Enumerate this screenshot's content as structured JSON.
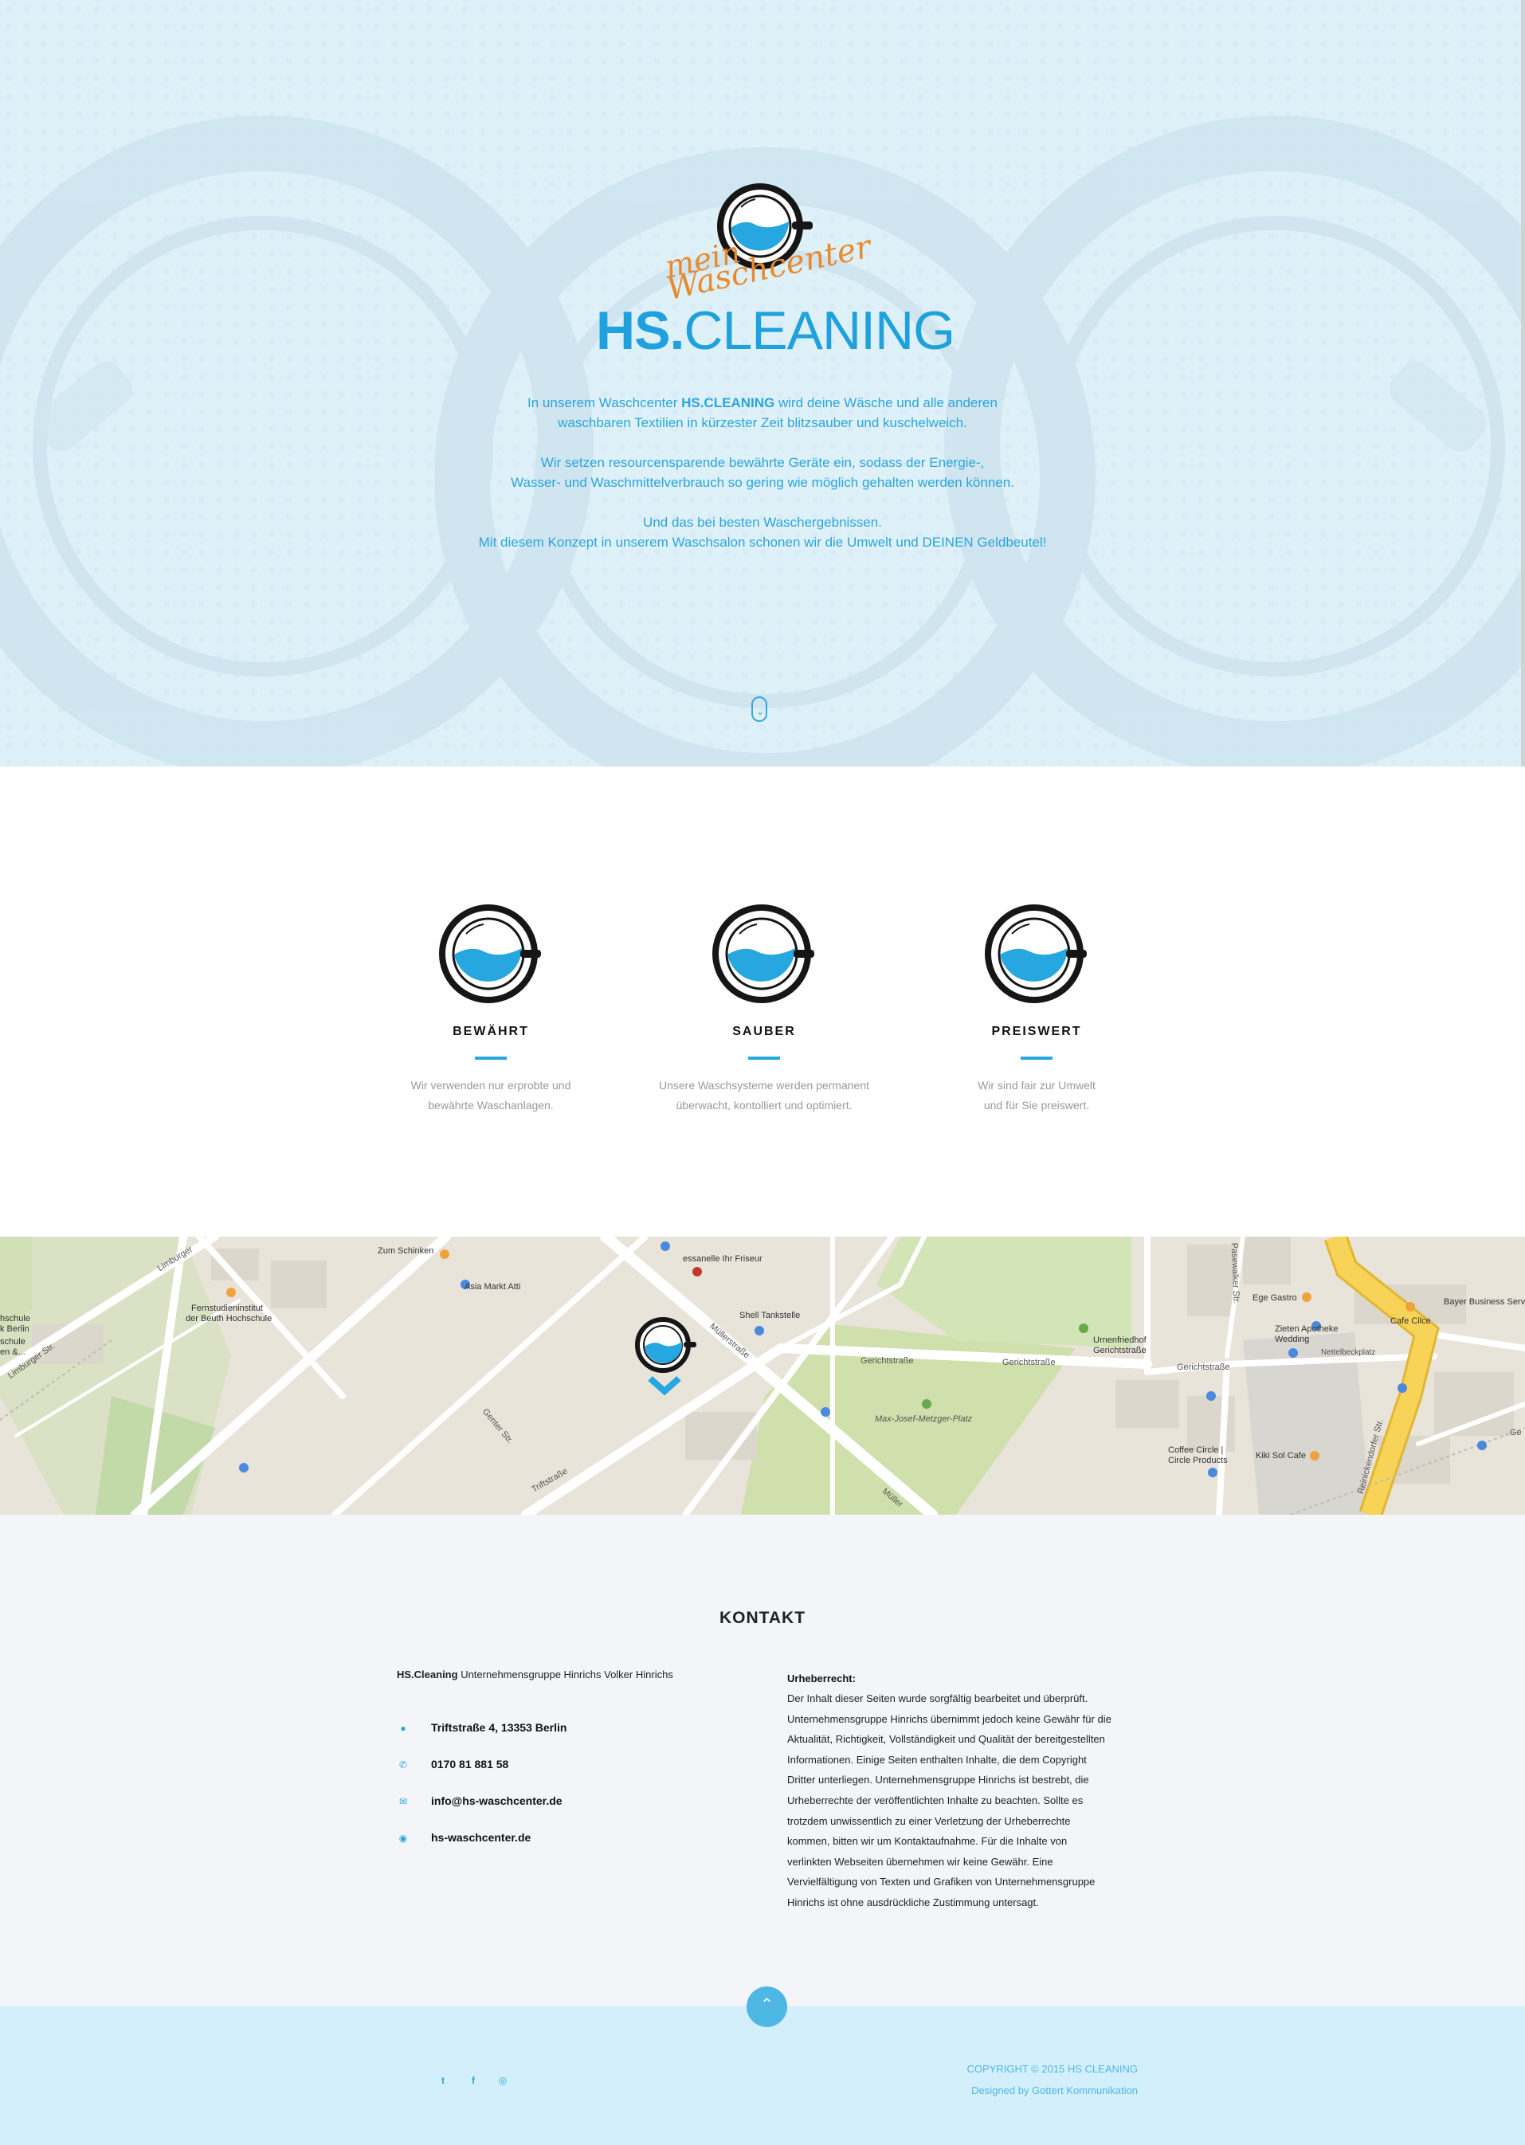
{
  "hero": {
    "logo": {
      "script_line1": "mein",
      "script_line2": "Waschcenter",
      "word_bold": "HS.",
      "word_thin": "CLEANING"
    },
    "p1_pre": "In unserem Waschcenter ",
    "p1_bold": "HS.CLEANING",
    "p1_post": " wird deine Wäsche und alle anderen",
    "p1_line2": "waschbaren Textilien in kürzester Zeit blitzsauber und kuschelweich.",
    "p2_line1": "Wir setzen resourcensparende bewährte Geräte ein, sodass der Energie-,",
    "p2_line2": "Wasser- und Waschmittelverbrauch so gering wie möglich gehalten werden können.",
    "p3_line1": "Und das bei besten Waschergebnissen.",
    "p3_line2": "Mit diesem Konzept in unserem Waschsalon schonen wir die Umwelt und DEINEN Geldbeutel!",
    "scroll_icon": "chevron-down-icon"
  },
  "features": [
    {
      "title": "BEWÄHRT",
      "line1": "Wir verwenden nur erprobte und",
      "line2": "bewährte Waschanlagen.",
      "icon": "washing-drum-icon"
    },
    {
      "title": "SAUBER",
      "line1": "Unsere Waschsysteme werden permanent",
      "line2": "überwacht, kontolliert und optimiert.",
      "icon": "washing-drum-icon"
    },
    {
      "title": "PREISWERT",
      "line1": "Wir sind fair zur Umwelt",
      "line2": "und für Sie preiswert.",
      "icon": "washing-drum-icon"
    }
  ],
  "map": {
    "labels": {
      "zum_schinken": "Zum Schinken",
      "asia_markt": "Asia Markt Atti",
      "friseur": "essanelle Ihr Friseur",
      "shell": "Shell Tankstelle",
      "fernstudien1": "Fernstudieninstitut",
      "fernstudien2": "der Beuth Hochschule",
      "hochschule1": "hschule",
      "hochschule2": "k Berlin",
      "hochschule3": "schule",
      "hochschule4": "en &...",
      "limburger1": "Limburger",
      "limburger2": "Limburger Str.",
      "genter": "Genter Str.",
      "trift": "Triftstraße",
      "mueller1": "Müllerstraße",
      "mueller2": "Müller",
      "gericht1": "Gerichtstraße",
      "gericht2": "Gerichtstraße",
      "gericht3": "Gerichtstraße",
      "urnenfriedhof1": "Urnenfriedhof",
      "urnenfriedhof2": "Gerichtstraße",
      "max_josef": "Max-Josef-Metzger-Platz",
      "pasewalker": "Pasewalker Str.",
      "ege": "Ege Gastro",
      "cafe_cilce": "Cafe Cilce",
      "zieten1": "Zieten Apotheke",
      "zieten2": "Wedding",
      "nettelbeck": "Nettelbeckplatz",
      "bayer": "Bayer Business Servi",
      "coffee1": "Coffee Circle |",
      "coffee2": "Circle Products",
      "kiki": "Kiki Sol Cafe",
      "reinickendorfer": "Reinickendorfer Str.",
      "ge": "Ge"
    },
    "marker_icon": "map-marker-icon"
  },
  "contact": {
    "title": "KONTAKT",
    "company_bold": "HS.Cleaning",
    "company_rest": " Unternehmensgruppe Hinrichs Volker Hinrichs",
    "address": "Triftstraße 4, 13353 Berlin",
    "phone": "0170 81 881 58",
    "email": "info@hs-waschcenter.de",
    "web": "hs-waschcenter.de",
    "copyright_title": "Urheberrecht:",
    "copyright_lines": [
      "Der Inhalt dieser Seiten wurde sorgfältig bearbeitet und überprüft.",
      "Unternehmensgruppe Hinrichs übernimmt jedoch keine Gewähr für die",
      "Aktualität, Richtigkeit, Vollständigkeit und Qualität der bereitgestellten",
      "Informationen. Einige Seiten enthalten Inhalte, die dem Copyright",
      "Dritter unterliegen. Unternehmensgruppe Hinrichs ist bestrebt, die",
      "Urheberrechte der veröffentlichten Inhalte zu beachten. Sollte es",
      "trotzdem unwissentlich zu einer Verletzung der Urheberrechte",
      "kommen, bitten wir um Kontaktaufnahme. Für die Inhalte von",
      "verlinkten Webseiten übernehmen wir keine Gewähr. Eine",
      "Vervielfältigung von Texten und Grafiken von Unternehmensgruppe",
      "Hinrichs ist ohne ausdrückliche Zustimmung untersagt."
    ]
  },
  "footer": {
    "copyright": "COPYRIGHT © 2015 HS CLEANING",
    "designed_by": "Designed by Gottert Kommunikation",
    "social": [
      "twitter-icon",
      "facebook-icon",
      "dribbble-icon"
    ],
    "to_top_icon": "chevron-up-icon"
  },
  "colors": {
    "accent": "#27a7e0",
    "orange": "#e98a2e",
    "hero_bg": "#dbeef7",
    "contact_bg": "#f3f5f8",
    "footer_bg": "#d3effb"
  }
}
